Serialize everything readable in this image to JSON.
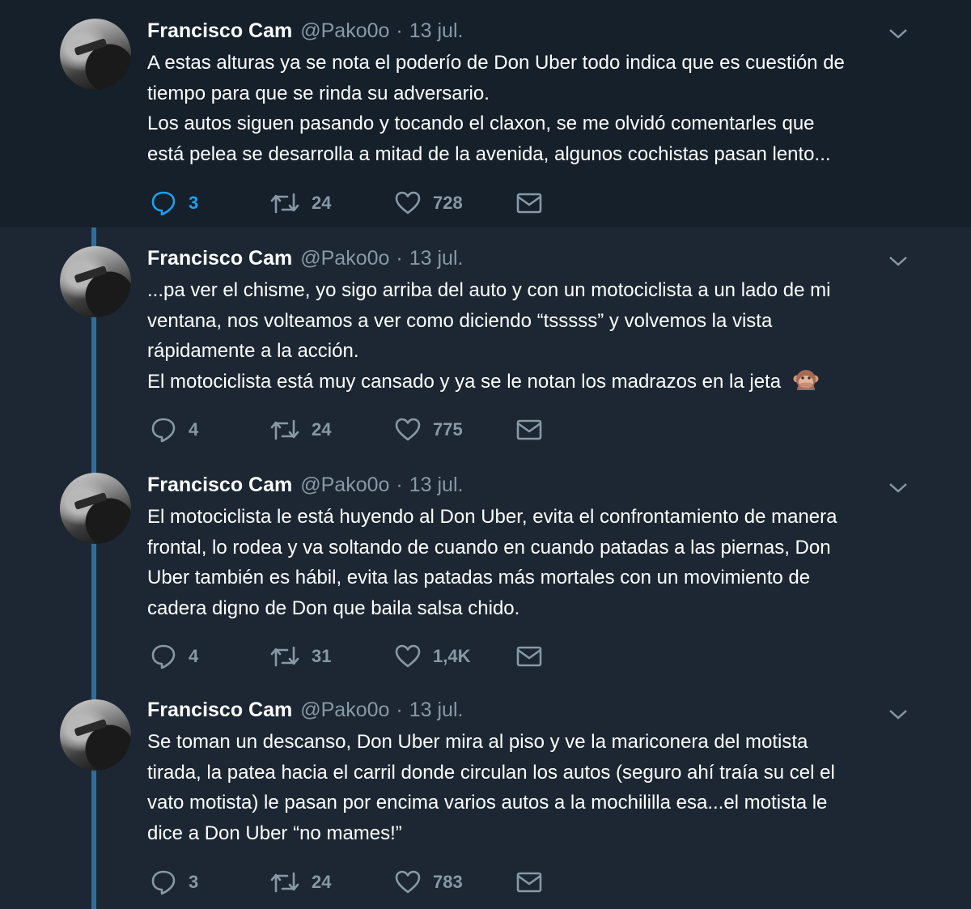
{
  "colors": {
    "background": "#1c2733",
    "highlight_background": "#15202b",
    "thread_line": "#2f6d9c",
    "text": "#ffffff",
    "muted": "#8899a6",
    "accent": "#1da1f2"
  },
  "tweets": [
    {
      "name": "Francisco Cam",
      "handle": "@Pako0o",
      "separator": "·",
      "date": "13 jul.",
      "lines": [
        "A estas alturas ya se nota el poderío de Don Uber todo indica que es cuestión de",
        "tiempo para que se rinda su adversario.",
        "Los autos siguen pasando y tocando el claxon, se me olvidó comentarles que",
        "está pelea se desarrolla a mitad de la avenida, algunos cochistas pasan lento..."
      ],
      "emoji": null,
      "replies": "3",
      "retweets": "24",
      "likes": "728",
      "reply_active": true
    },
    {
      "name": "Francisco Cam",
      "handle": "@Pako0o",
      "separator": "·",
      "date": "13 jul.",
      "lines": [
        "...pa ver el chisme, yo sigo arriba del auto y con un motociclista a un lado de mi",
        "ventana, nos volteamos a ver como diciendo “tsssss” y volvemos la vista",
        "rápidamente a la acción.",
        "El motociclista está muy cansado y ya se le notan los madrazos en la jeta"
      ],
      "emoji": "speak-no-evil-monkey-icon",
      "replies": "4",
      "retweets": "24",
      "likes": "775",
      "reply_active": false
    },
    {
      "name": "Francisco Cam",
      "handle": "@Pako0o",
      "separator": "·",
      "date": "13 jul.",
      "lines": [
        "El motociclista le está huyendo al Don Uber, evita el confrontamiento de manera",
        "frontal, lo rodea y va soltando de cuando en cuando  patadas a las piernas, Don",
        "Uber también es hábil, evita las patadas más mortales con un movimiento de",
        "cadera digno de Don que baila salsa chido."
      ],
      "emoji": null,
      "replies": "4",
      "retweets": "31",
      "likes": "1,4K",
      "reply_active": false
    },
    {
      "name": "Francisco Cam",
      "handle": "@Pako0o",
      "separator": "·",
      "date": "13 jul.",
      "lines": [
        "Se toman un descanso, Don Uber mira al piso y ve la mariconera del motista",
        "tirada, la patea hacia el carril donde circulan los autos (seguro ahí traía su cel el",
        "vato motista) le pasan por encima varios autos a la mochililla esa...el motista le",
        "dice a Don Uber “no mames!”"
      ],
      "emoji": null,
      "replies": "3",
      "retweets": "24",
      "likes": "783",
      "reply_active": false
    }
  ]
}
